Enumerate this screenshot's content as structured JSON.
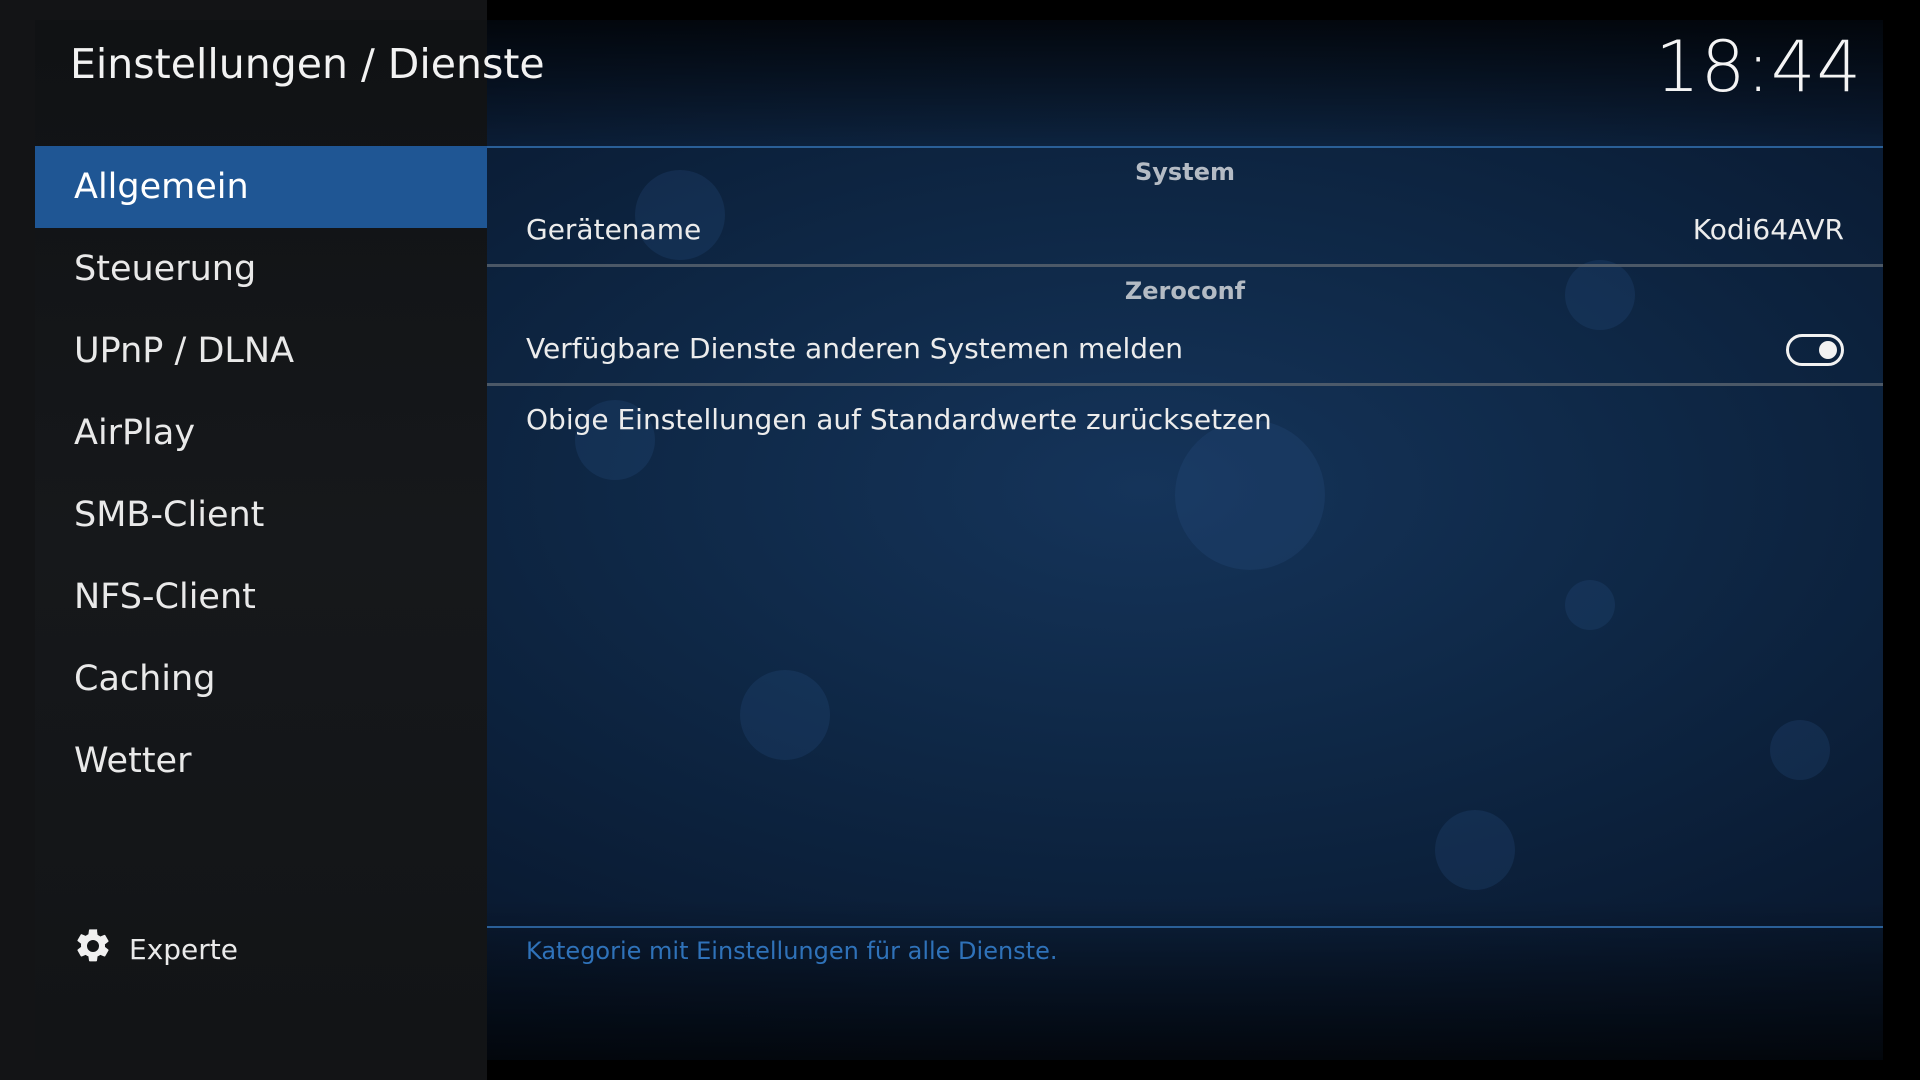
{
  "header": {
    "title": "Einstellungen / Dienste",
    "clock": "18:44"
  },
  "sidebar": {
    "items": [
      {
        "label": "Allgemein",
        "active": true
      },
      {
        "label": "Steuerung",
        "active": false
      },
      {
        "label": "UPnP / DLNA",
        "active": false
      },
      {
        "label": "AirPlay",
        "active": false
      },
      {
        "label": "SMB-Client",
        "active": false
      },
      {
        "label": "NFS-Client",
        "active": false
      },
      {
        "label": "Caching",
        "active": false
      },
      {
        "label": "Wetter",
        "active": false
      }
    ],
    "level_button": {
      "label": "Experte",
      "icon": "gear-icon"
    }
  },
  "settings": {
    "groups": [
      {
        "header": "System",
        "rows": [
          {
            "label": "Gerätename",
            "value": "Kodi64AVR"
          }
        ]
      },
      {
        "header": "Zeroconf",
        "rows": [
          {
            "label": "Verfügbare Dienste anderen Systemen melden",
            "toggle": true
          }
        ]
      }
    ],
    "reset_label": "Obige Einstellungen auf Standardwerte zurücksetzen"
  },
  "description": "Kategorie mit Einstellungen für alle Dienste.",
  "colors": {
    "accent": "#1f5694",
    "description_text": "#2f72b9"
  }
}
